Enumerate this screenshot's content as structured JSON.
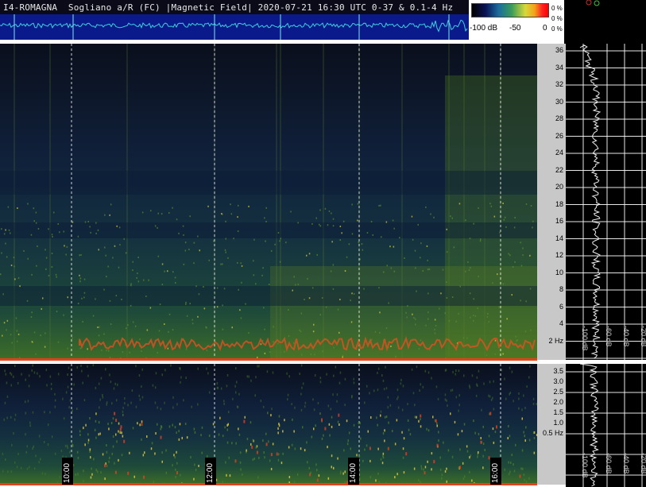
{
  "header": {
    "title": "I4-ROMAGNA  Sogliano a/R (FC) |Magnetic Field| 2020-07-21 16:30 UTC 0-37 & 0.1-4 Hz"
  },
  "colorbar": {
    "labels": [
      "-100 dB",
      "-50",
      "0"
    ],
    "percent_labels": [
      "0 %",
      "0 %",
      "0 %"
    ]
  },
  "main_axis": {
    "ticks": [
      "36",
      "34",
      "32",
      "30",
      "28",
      "26",
      "24",
      "22",
      "20",
      "18",
      "16",
      "14",
      "12",
      "10",
      "8",
      "6",
      "4",
      "2 Hz"
    ]
  },
  "low_axis": {
    "ticks": [
      "3.5",
      "3.0",
      "2.5",
      "2.0",
      "1.5",
      "1.0",
      "0.5 Hz"
    ]
  },
  "profile_main": {
    "db_labels": [
      "-100 dB",
      "-60 dB",
      "-40 dB",
      "-20 dB"
    ]
  },
  "profile_low": {
    "db_labels": [
      "-100 dB",
      "-60 dB",
      "-40 dB",
      "-20 dB"
    ]
  },
  "time_labels": [
    "10:00",
    "12:00",
    "14:00",
    "16:00"
  ],
  "colors": {
    "red_band": "#e8401a",
    "grid": "#ffffff",
    "waveform": "#3ad0e0"
  }
}
